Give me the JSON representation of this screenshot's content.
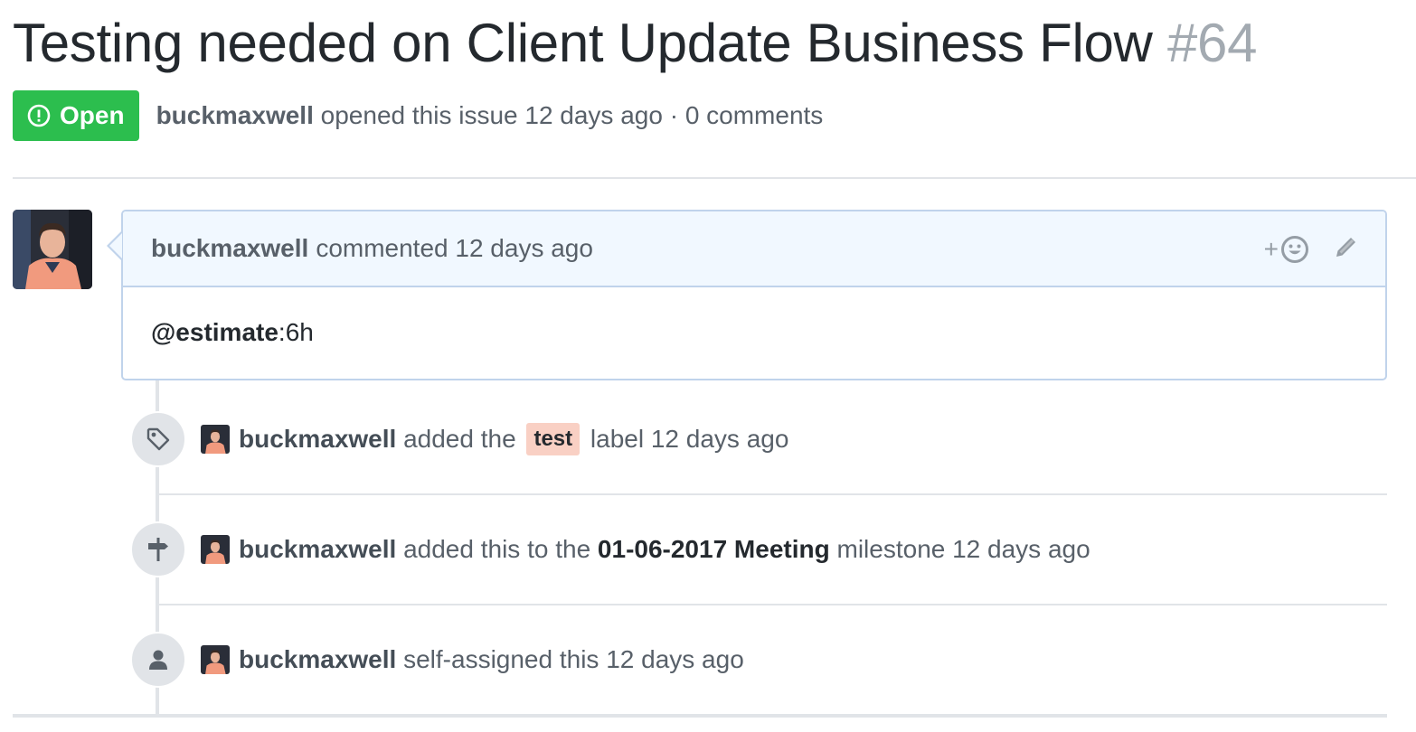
{
  "issue": {
    "title": "Testing needed on Client Update Business Flow",
    "number": "#64",
    "state_label": "Open",
    "author": "buckmaxwell",
    "opened_text": "opened this issue 12 days ago · 0 comments"
  },
  "comment": {
    "author": "buckmaxwell",
    "action_text": "commented 12 days ago",
    "react_label": "+",
    "body_mention": "@estimate",
    "body_rest": ":6h"
  },
  "events": [
    {
      "icon": "tag-icon",
      "user": "buckmaxwell",
      "pre": "added the",
      "label": "test",
      "post": "label 12 days ago"
    },
    {
      "icon": "milestone-icon",
      "user": "buckmaxwell",
      "pre": "added this to the",
      "strong": "01-06-2017 Meeting",
      "post": "milestone 12 days ago"
    },
    {
      "icon": "person-icon",
      "user": "buckmaxwell",
      "pre": "self-assigned this 12 days ago"
    }
  ],
  "colors": {
    "open_green": "#2cbe4e",
    "comment_header_bg": "#f1f8ff",
    "comment_border": "#c0d3eb",
    "label_test_bg": "#f9d0c4"
  }
}
